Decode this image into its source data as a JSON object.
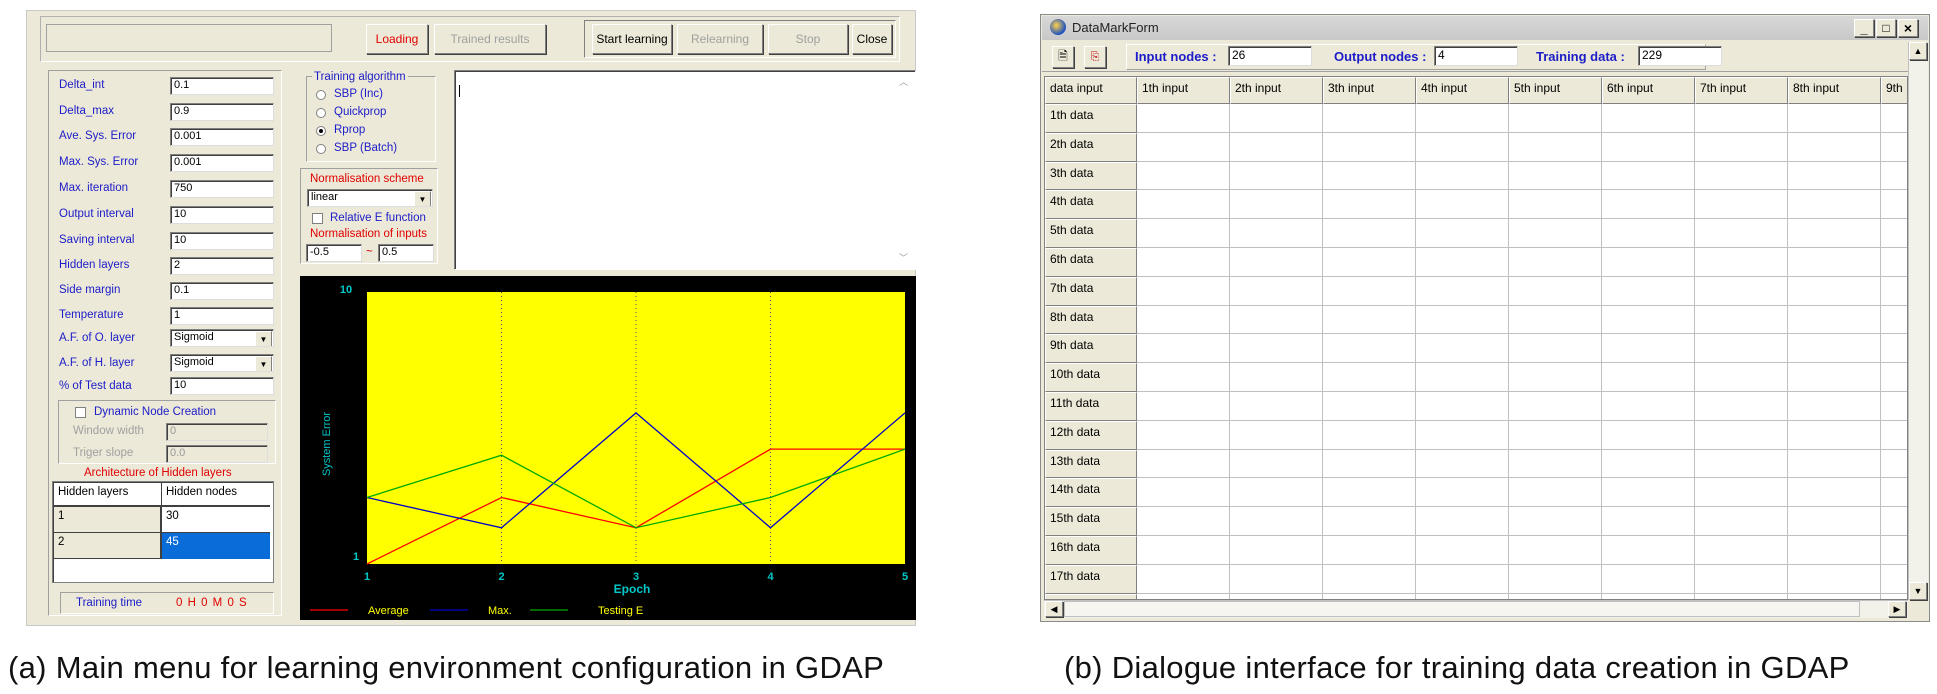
{
  "left": {
    "buttons": {
      "loading": "Loading",
      "trained_results": "Trained results",
      "start_learning": "Start learning",
      "relearning": "Relearning",
      "stop": "Stop",
      "close": "Close"
    },
    "params": [
      {
        "label": "Delta_int",
        "value": "0.1"
      },
      {
        "label": "Delta_max",
        "value": "0.9"
      },
      {
        "label": "Ave. Sys. Error",
        "value": "0.001"
      },
      {
        "label": "Max. Sys. Error",
        "value": "0.001"
      },
      {
        "label": "Max. iteration",
        "value": "750"
      },
      {
        "label": "Output interval",
        "value": "10"
      },
      {
        "label": "Saving interval",
        "value": "10"
      },
      {
        "label": "Hidden layers",
        "value": "2"
      },
      {
        "label": "Side margin",
        "value": "0.1"
      },
      {
        "label": "Temperature",
        "value": "1"
      }
    ],
    "af_o_label": "A.F. of O. layer",
    "af_o_value": "Sigmoid",
    "af_h_label": "A.F. of H. layer",
    "af_h_value": "Sigmoid",
    "test_data_label": "% of Test data",
    "test_data_value": "10",
    "dynamic_node_label": "Dynamic Node Creation",
    "window_width_label": "Window width",
    "window_width_value": "0",
    "triger_slope_label": "Triger slope",
    "triger_slope_value": "0.0",
    "arch_title": "Architecture of Hidden layers",
    "arch_headers": [
      "Hidden layers",
      "Hidden nodes"
    ],
    "arch_rows": [
      [
        "1",
        "30"
      ],
      [
        "2",
        "45"
      ]
    ],
    "training_time_label": "Training time",
    "training_time_value": "0 H 0 M  0 S",
    "algo_title": "Training algorithm",
    "algorithms": [
      "SBP (Inc)",
      "Quickprop",
      "Rprop",
      "SBP (Batch)"
    ],
    "selected_algorithm": "Rprop",
    "norm_scheme_title": "Normalisation scheme",
    "norm_scheme_value": "linear",
    "relative_e_label": "Relative E function",
    "norm_inputs_title": "Normalisation of inputs",
    "norm_min": "-0.5",
    "norm_dash": "~",
    "norm_max": "0.5",
    "colors": {
      "plot_bg": "#ffff00",
      "average": "#ff0000",
      "max": "#0000cc",
      "testing": "#00aa00"
    }
  },
  "chart_data": {
    "type": "line",
    "x": [
      1,
      2,
      3,
      4,
      5
    ],
    "series": [
      {
        "name": "Average",
        "values": [
          1,
          3.2,
          2.2,
          4.8,
          4.8
        ]
      },
      {
        "name": "Max.",
        "values": [
          3.2,
          2.2,
          6.0,
          2.2,
          6.0
        ]
      },
      {
        "name": "Testing E",
        "values": [
          3.2,
          4.6,
          2.2,
          3.2,
          4.8
        ]
      }
    ],
    "ylabel": "System Error",
    "xlabel": "Epoch",
    "y_ticks": [
      "10",
      "1"
    ],
    "x_ticks": [
      "1",
      "2",
      "3",
      "4",
      "5"
    ],
    "ylim": [
      1,
      10
    ],
    "xlim": [
      1,
      5
    ],
    "grid": "vertical dotted",
    "legend": "bottom"
  },
  "right": {
    "window_title": "DataMarkForm",
    "input_nodes_label": "Input nodes :",
    "input_nodes_value": "26",
    "output_nodes_label": "Output nodes :",
    "output_nodes_value": "4",
    "training_data_label": "Training data :",
    "training_data_value": "229",
    "corner_header": "data input",
    "col_headers": [
      "1th input",
      "2th input",
      "3th input",
      "4th input",
      "5th input",
      "6th input",
      "7th input",
      "8th input",
      "9th"
    ],
    "row_headers": [
      "1th data",
      "2th data",
      "3th data",
      "4th data",
      "5th data",
      "6th data",
      "7th data",
      "8th data",
      "9th data",
      "10th data",
      "11th data",
      "12th data",
      "13th data",
      "14th data",
      "15th data",
      "16th data",
      "17th data"
    ]
  },
  "captions": {
    "a": "(a) Main menu for learning environment configuration in GDAP",
    "b": "(b) Dialogue interface for training data creation in GDAP"
  }
}
